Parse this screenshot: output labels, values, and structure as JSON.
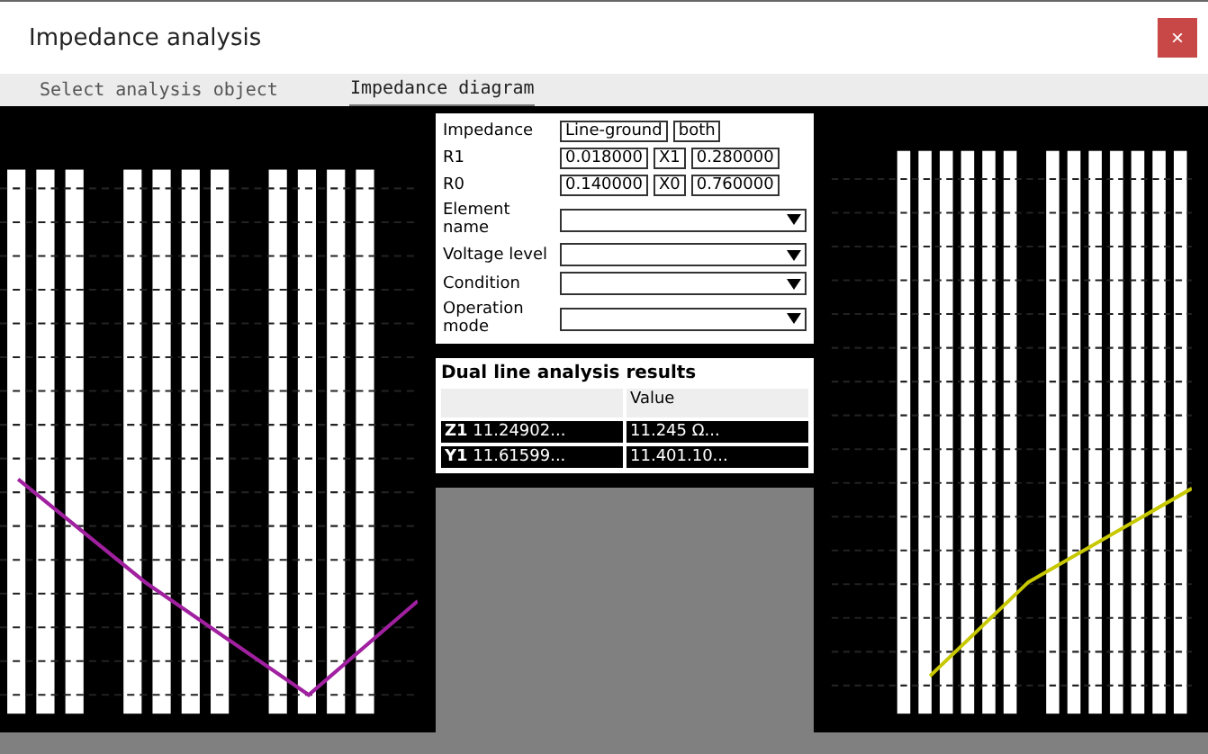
{
  "window": {
    "title": "Impedance analysis",
    "close": "×"
  },
  "tabs": [
    {
      "label": "Select analysis object",
      "selected": false
    },
    {
      "label": "Impedance diagram",
      "selected": true
    }
  ],
  "parameters": [
    {
      "label": "Impedance",
      "fields": [
        "Line-ground",
        "both"
      ]
    },
    {
      "label": "R1",
      "fields": [
        "0.018000",
        "X1",
        "0.280000"
      ]
    },
    {
      "label": "R0",
      "fields": [
        "0.140000",
        "X0",
        "0.760000"
      ]
    },
    {
      "label": "Element name"
    },
    {
      "label": "Voltage level"
    },
    {
      "label": "Condition"
    },
    {
      "label": "Operation mode"
    }
  ],
  "results": {
    "title": "Dual line analysis results",
    "columns": [
      "",
      "Value"
    ],
    "rows": [
      {
        "name": "Z1",
        "cells": [
          "11.24902...",
          "11.245 Ω..."
        ]
      },
      {
        "name": "Y1",
        "cells": [
          "11.61599...",
          "11.401.10..."
        ]
      }
    ]
  }
}
